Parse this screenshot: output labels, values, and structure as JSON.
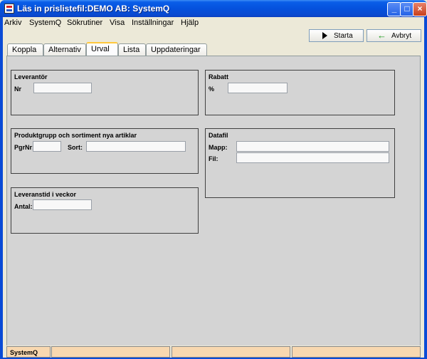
{
  "window": {
    "title": "Läs in prislistefil:DEMO AB: SystemQ"
  },
  "menu": [
    {
      "label": "Arkiv"
    },
    {
      "label": "SystemQ"
    },
    {
      "label": "Sökrutiner"
    },
    {
      "label": "Visa"
    },
    {
      "label": "Inställningar"
    },
    {
      "label": "Hjälp"
    }
  ],
  "toolbar": {
    "start_label": "Starta",
    "cancel_label": "Avbryt"
  },
  "tabs": [
    {
      "label": "Koppla"
    },
    {
      "label": "Alternativ"
    },
    {
      "label": "Urval",
      "active": true
    },
    {
      "label": "Lista"
    },
    {
      "label": "Uppdateringar"
    }
  ],
  "groups": {
    "leverantor": {
      "title": "Leverantör",
      "nr_label": "Nr",
      "nr_value": ""
    },
    "rabatt": {
      "title": "Rabatt",
      "pct_label": "%",
      "pct_value": ""
    },
    "produktgrupp": {
      "title": "Produktgrupp och sortiment nya artiklar",
      "pgrnr_label": "PgrNr:",
      "pgrnr_value": "",
      "sort_label": "Sort:",
      "sort_value": ""
    },
    "datafil": {
      "title": "Datafil",
      "mapp_label": "Mapp:",
      "mapp_value": "",
      "fil_label": "Fil:",
      "fil_value": ""
    },
    "leveranstid": {
      "title": "Leveranstid i veckor",
      "antal_label": "Antal:",
      "antal_value": ""
    }
  },
  "status": {
    "app": "SystemQ",
    "cells": [
      "",
      "",
      ""
    ]
  },
  "colors": {
    "title_bar": "#0a5ee8",
    "panel": "#d4d4d4",
    "status_cell": "#f8d8b0"
  }
}
